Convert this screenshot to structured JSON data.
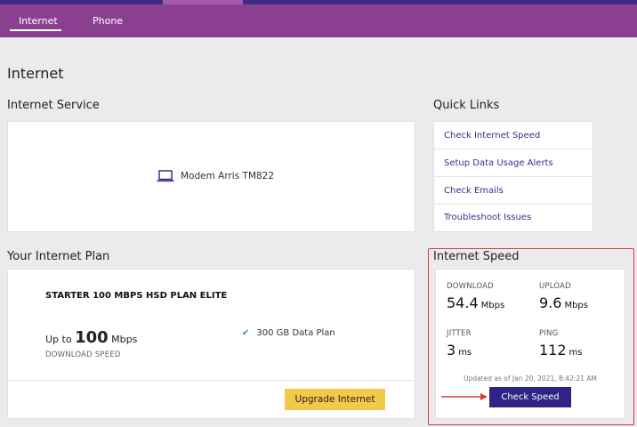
{
  "nav": {
    "tabs": [
      {
        "label": "Internet"
      },
      {
        "label": "Phone"
      }
    ]
  },
  "page": {
    "title": "Internet"
  },
  "internet_service": {
    "title": "Internet Service",
    "modem_icon": "laptop-icon",
    "modem_label": "Modem Arris TM822"
  },
  "quick_links": {
    "title": "Quick Links",
    "items": [
      {
        "label": "Check Internet Speed"
      },
      {
        "label": "Setup Data Usage Alerts"
      },
      {
        "label": "Check Emails"
      },
      {
        "label": "Troubleshoot Issues"
      }
    ]
  },
  "plan": {
    "title": "Your Internet Plan",
    "name": "STARTER 100 MBPS HSD PLAN ELITE",
    "up_to_prefix": "Up to",
    "speed_value": "100",
    "speed_unit": "Mbps",
    "speed_label": "DOWNLOAD SPEED",
    "data_plan": "300 GB Data Plan",
    "upgrade_label": "Upgrade Internet"
  },
  "speed": {
    "title": "Internet Speed",
    "download": {
      "label": "DOWNLOAD",
      "value": "54.4",
      "unit": "Mbps"
    },
    "upload": {
      "label": "UPLOAD",
      "value": "9.6",
      "unit": "Mbps"
    },
    "jitter": {
      "label": "JITTER",
      "value": "3",
      "unit": "ms"
    },
    "ping": {
      "label": "PING",
      "value": "112",
      "unit": "ms"
    },
    "updated": "Updated as of Jan 20, 2021, 8:42:21 AM",
    "check_label": "Check Speed"
  },
  "colors": {
    "header": "#8b3f91",
    "accent": "#2f2386",
    "link": "#3a2e8c",
    "upgrade": "#f4c94a",
    "highlight": "#d83a3a"
  }
}
